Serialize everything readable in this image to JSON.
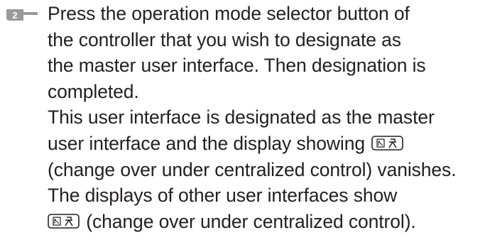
{
  "step": {
    "number": "2",
    "icon": "step-number-badge-icon"
  },
  "paragraph1": {
    "line1": "Press the operation mode selector button of",
    "line2": "the controller that you wish to designate as",
    "line3": "the master user interface. Then designation is",
    "line4": "completed."
  },
  "paragraph2": {
    "line1": "This user interface is designated as the master",
    "line2_prefix": "user interface and the display showing",
    "line3": "(change over under centralized control) vanishes."
  },
  "paragraph3": {
    "line1": "The displays of other user interfaces show",
    "line2_suffix": " (change over under centralized control)."
  },
  "icons": {
    "changeover_icon": "changeover-under-centralized-control-icon"
  },
  "colors": {
    "text": "#231f20",
    "badge": "#9a9a9a"
  }
}
